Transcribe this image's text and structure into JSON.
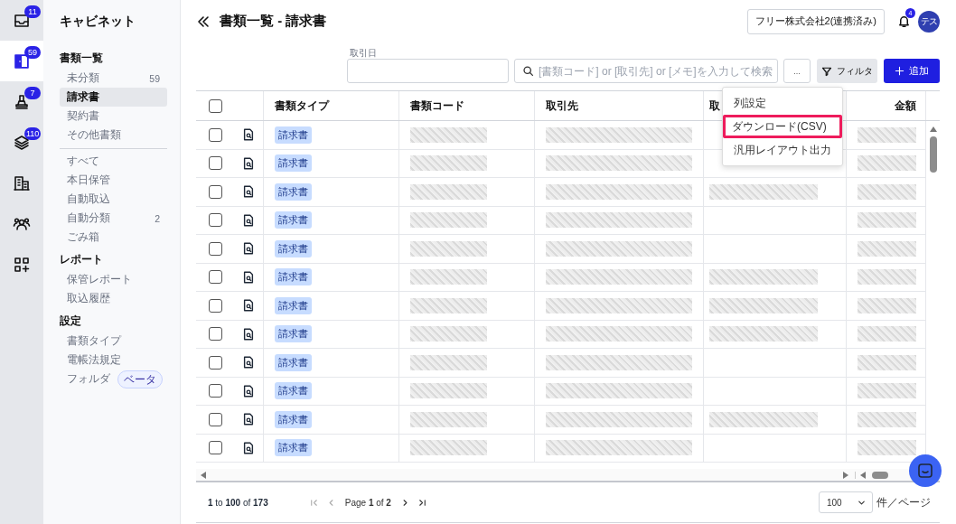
{
  "rail": [
    {
      "kind": "inbox",
      "badge": "11",
      "selected": false
    },
    {
      "kind": "door",
      "badge": "59",
      "selected": true
    },
    {
      "kind": "stamp",
      "badge": "7",
      "selected": false
    },
    {
      "kind": "layers",
      "badge": "110",
      "selected": false
    },
    {
      "kind": "building",
      "selected": false
    },
    {
      "kind": "people",
      "selected": false
    },
    {
      "kind": "apps",
      "selected": false
    }
  ],
  "sidebar": {
    "title": "キャビネット",
    "sections": [
      {
        "heading": "書類一覧",
        "items": [
          {
            "label": "未分類",
            "count": "59",
            "selected": false
          },
          {
            "label": "請求書",
            "selected": true
          },
          {
            "label": "契約書",
            "selected": false
          },
          {
            "label": "その他書類",
            "selected": false
          }
        ]
      },
      {
        "divider": true,
        "items": [
          {
            "label": "すべて",
            "selected": false
          },
          {
            "label": "本日保管",
            "selected": false
          },
          {
            "label": "自動取込",
            "selected": false
          },
          {
            "label": "自動分類",
            "count": "2",
            "selected": false
          },
          {
            "label": "ごみ箱",
            "selected": false
          }
        ]
      },
      {
        "heading": "レポート",
        "items": [
          {
            "label": "保管レポート",
            "selected": false
          },
          {
            "label": "取込履歴",
            "selected": false
          }
        ]
      },
      {
        "heading": "設定",
        "items": [
          {
            "label": "書類タイプ",
            "selected": false
          },
          {
            "label": "電帳法規定",
            "selected": false
          },
          {
            "label": "フォルダ",
            "tag": "ベータ",
            "selected": false
          }
        ]
      }
    ]
  },
  "header": {
    "title": "書類一覧 - 請求書",
    "company": "フリー株式会社2(連携済み)",
    "notification_badge": "4",
    "avatar": "テス"
  },
  "toolbar": {
    "date_label": "取引日",
    "search_placeholder": "[書類コード] or [取引先] or [メモ]を入力して検索",
    "more": "...",
    "filter": "フィルタ",
    "add": "追加"
  },
  "table": {
    "select_all_checked": false,
    "columns": [
      "書類タイプ",
      "書類コード",
      "取引先",
      "取",
      "金額"
    ],
    "rows": [
      {
        "checked": false,
        "doc_type": "請求書",
        "redacted": [
          true,
          true,
          false,
          true
        ]
      },
      {
        "checked": false,
        "doc_type": "請求書",
        "redacted": [
          true,
          true,
          false,
          true
        ]
      },
      {
        "checked": false,
        "doc_type": "請求書",
        "redacted": [
          true,
          true,
          true,
          true
        ]
      },
      {
        "checked": false,
        "doc_type": "請求書",
        "redacted": [
          true,
          true,
          false,
          true
        ]
      },
      {
        "checked": false,
        "doc_type": "請求書",
        "redacted": [
          true,
          true,
          false,
          true
        ]
      },
      {
        "checked": false,
        "doc_type": "請求書",
        "redacted": [
          true,
          true,
          true,
          true
        ]
      },
      {
        "checked": false,
        "doc_type": "請求書",
        "redacted": [
          true,
          true,
          true,
          true
        ]
      },
      {
        "checked": false,
        "doc_type": "請求書",
        "redacted": [
          true,
          true,
          true,
          true
        ]
      },
      {
        "checked": false,
        "doc_type": "請求書",
        "redacted": [
          true,
          true,
          false,
          true
        ]
      },
      {
        "checked": false,
        "doc_type": "請求書",
        "redacted": [
          true,
          true,
          false,
          true
        ]
      },
      {
        "checked": false,
        "doc_type": "請求書",
        "redacted": [
          true,
          true,
          true,
          true
        ]
      },
      {
        "checked": false,
        "doc_type": "請求書",
        "redacted": [
          true,
          true,
          false,
          true
        ]
      }
    ]
  },
  "menu": {
    "items": [
      {
        "label": "列設定",
        "highlighted": false
      },
      {
        "label": "ダウンロード(CSV)",
        "highlighted": true
      },
      {
        "label": "汎用レイアウト出力",
        "highlighted": false
      }
    ]
  },
  "footer": {
    "range": "**1** to **100** of **173**",
    "page": "Page **1** of **2**",
    "page_size": "100",
    "per_page": "件／ページ"
  }
}
